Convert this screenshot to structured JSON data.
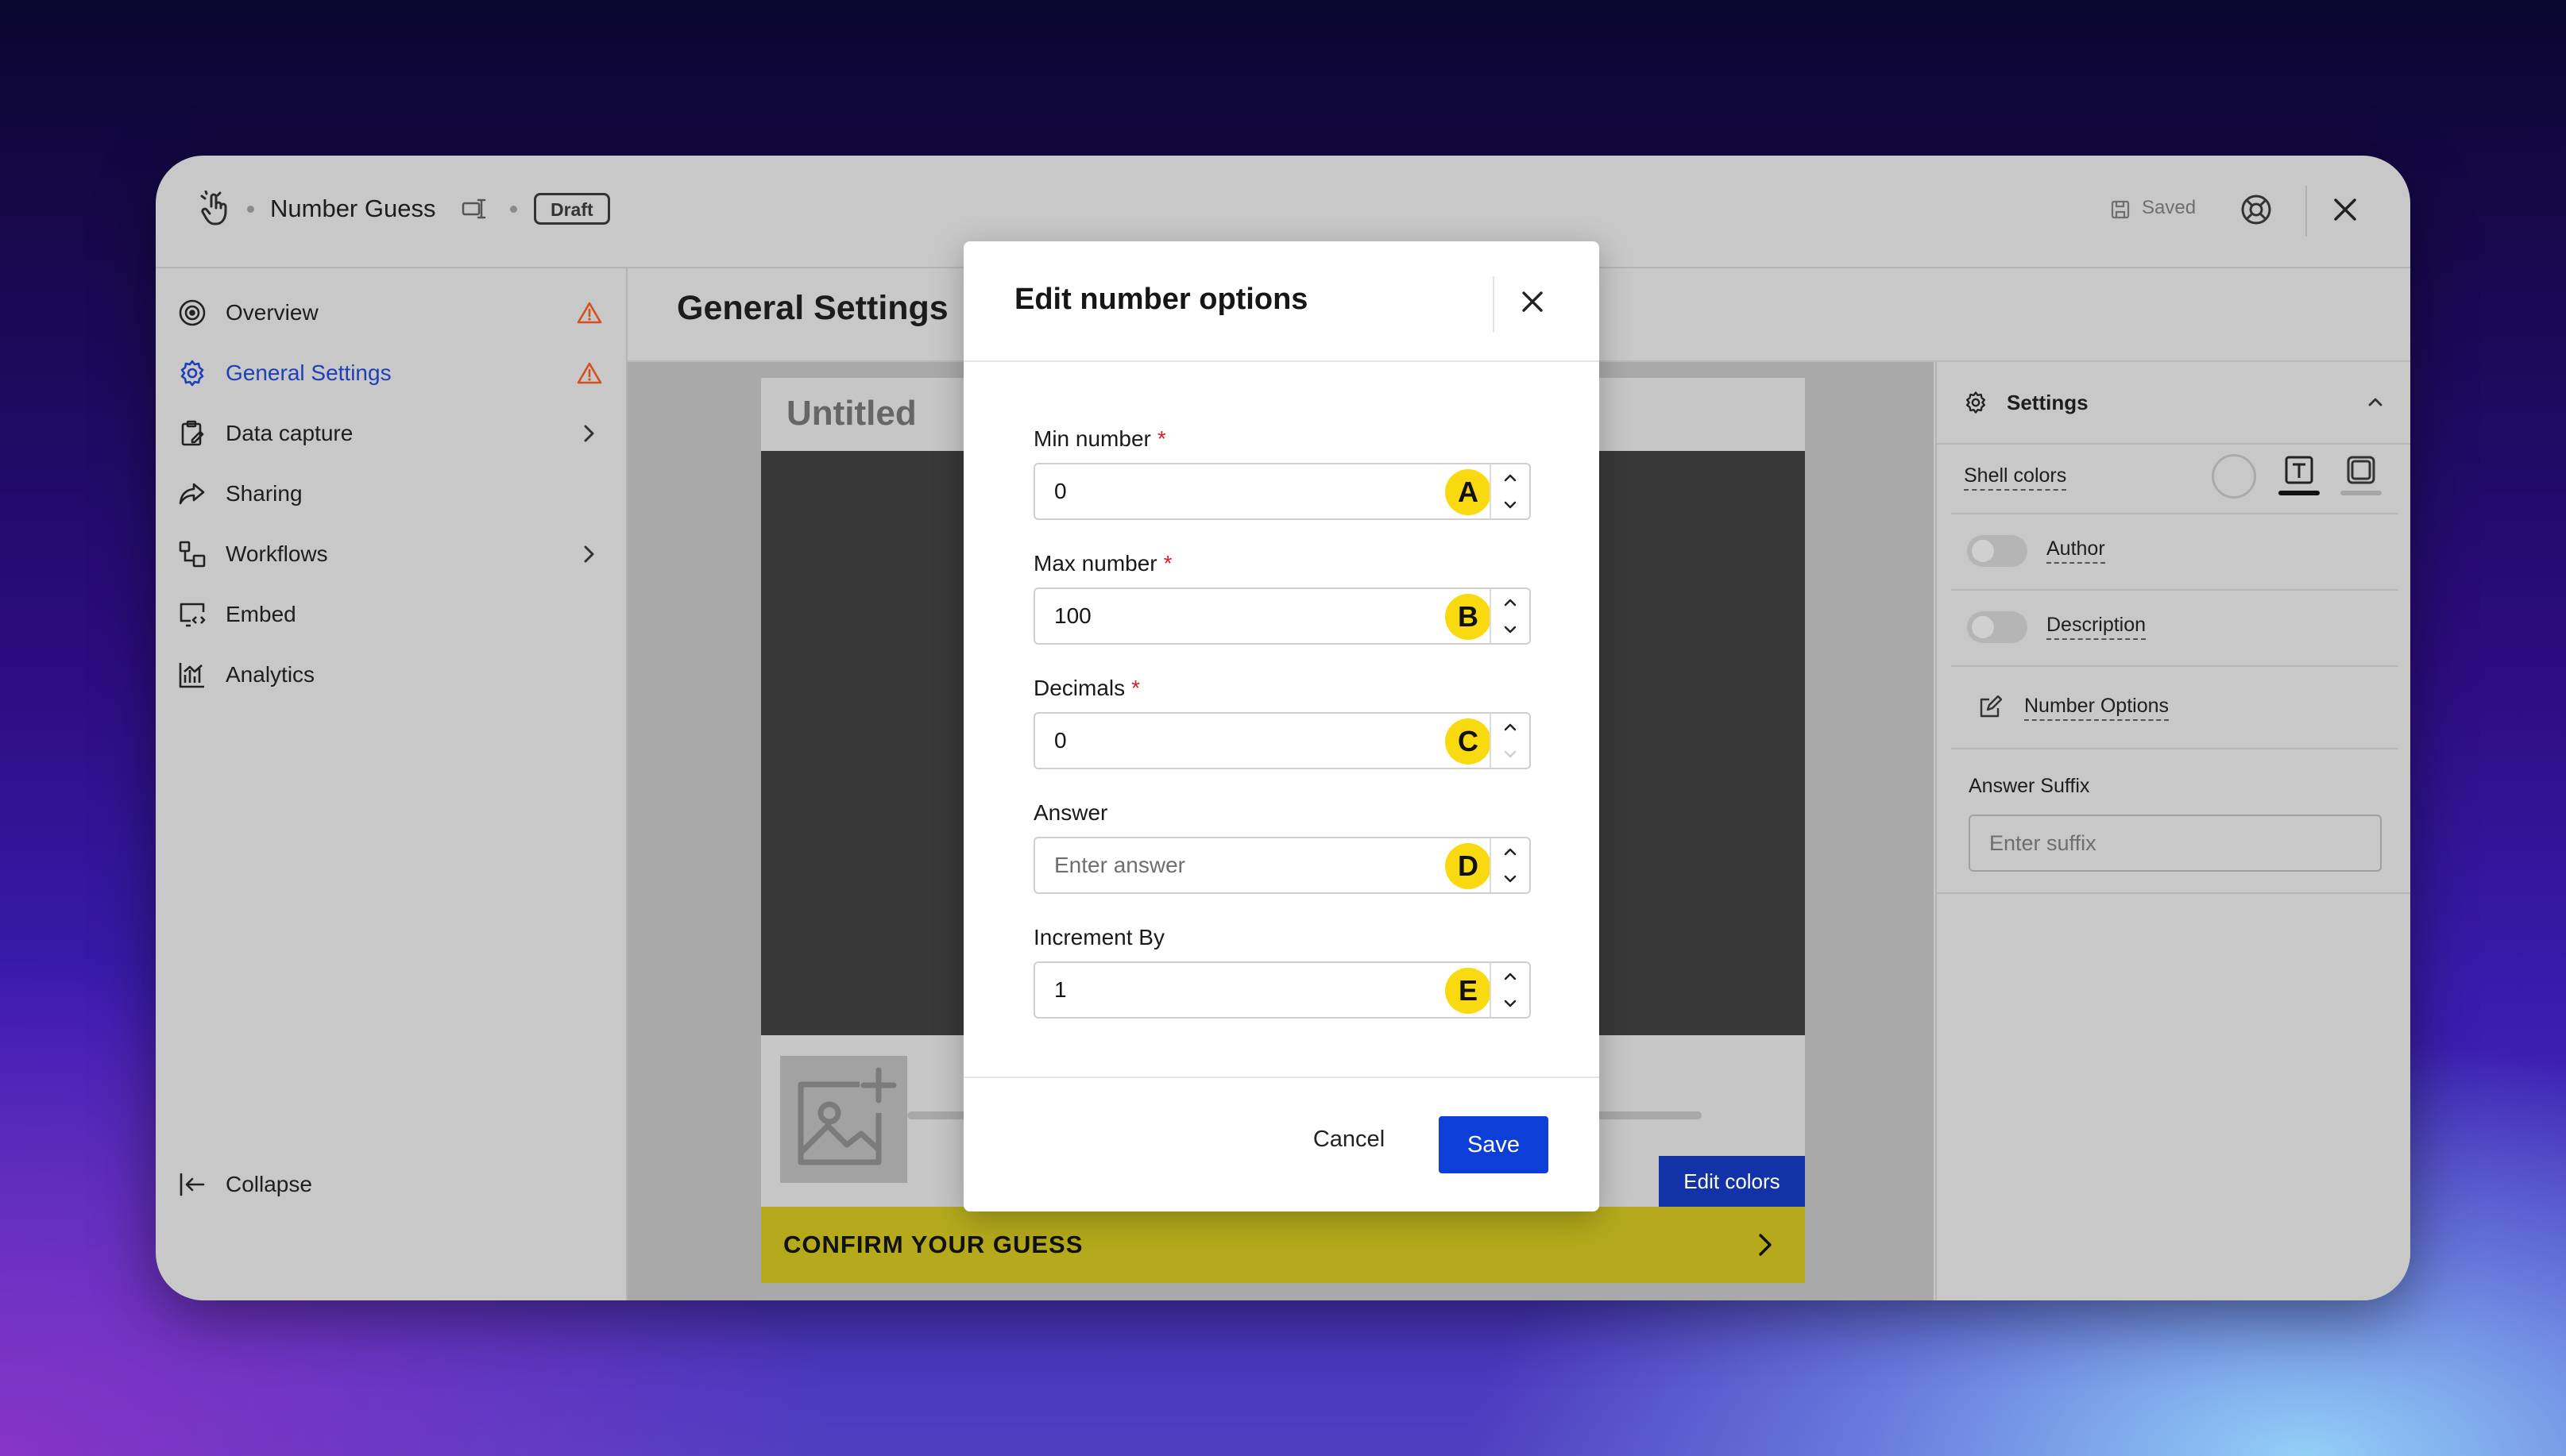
{
  "app": {
    "title": "Number Guess",
    "badge": "Draft",
    "saved_status": "Saved"
  },
  "sidebar": {
    "items": [
      {
        "label": "Overview",
        "icon": "target-icon",
        "warning": true
      },
      {
        "label": "General Settings",
        "icon": "gear-icon",
        "warning": true,
        "active": true
      },
      {
        "label": "Data capture",
        "icon": "clipboard-icon",
        "chevron": true
      },
      {
        "label": "Sharing",
        "icon": "share-icon"
      },
      {
        "label": "Workflows",
        "icon": "workflow-icon",
        "chevron": true
      },
      {
        "label": "Embed",
        "icon": "embed-icon"
      },
      {
        "label": "Analytics",
        "icon": "analytics-icon"
      }
    ],
    "collapse_label": "Collapse"
  },
  "main": {
    "title": "General Settings"
  },
  "preview": {
    "title": "Untitled",
    "edit_colors_label": "Edit colors",
    "confirm_label": "CONFIRM YOUR GUESS"
  },
  "settings_panel": {
    "header": "Settings",
    "shell_colors_label": "Shell colors",
    "author_label": "Author",
    "description_label": "Description",
    "number_options_label": "Number Options",
    "answer_suffix_label": "Answer Suffix",
    "answer_suffix_placeholder": "Enter suffix"
  },
  "modal": {
    "title": "Edit number options",
    "fields": [
      {
        "label": "Min number",
        "required": true,
        "value": "0",
        "badge": "A"
      },
      {
        "label": "Max number",
        "required": true,
        "value": "100",
        "badge": "B"
      },
      {
        "label": "Decimals",
        "required": true,
        "value": "0",
        "badge": "C"
      },
      {
        "label": "Answer",
        "required": false,
        "value": "",
        "placeholder": "Enter answer",
        "badge": "D"
      },
      {
        "label": "Increment By",
        "required": false,
        "value": "1",
        "badge": "E"
      }
    ],
    "required_marker": "*",
    "cancel_label": "Cancel",
    "save_label": "Save"
  },
  "colors": {
    "accent": "#1f3fb8",
    "save_button": "#0d3fd8",
    "badge": "#f9d90f",
    "warning": "#d6501f",
    "confirm_bar": "#b5aa1c"
  }
}
